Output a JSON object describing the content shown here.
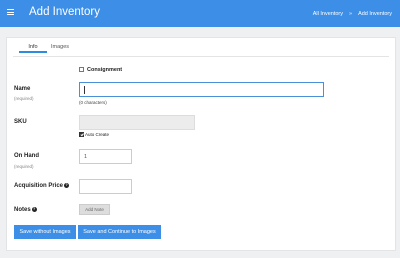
{
  "header": {
    "title": "Add Inventory",
    "breadcrumbs": [
      "All Inventory",
      "Add Inventory"
    ],
    "breadcrumb_separator": "»"
  },
  "tabs": [
    {
      "label": "Info",
      "active": true
    },
    {
      "label": "Images",
      "active": false
    }
  ],
  "form": {
    "consignment_label": "Consignment",
    "name_label": "Name",
    "name_required": "(required)",
    "name_value": "",
    "name_counter": "(0 characters)",
    "sku_label": "SKU",
    "sku_value": "",
    "auto_create_label": "Auto Create",
    "on_hand_label": "On Hand",
    "on_hand_required": "(required)",
    "on_hand_value": "1",
    "acquisition_label": "Acquisition Price",
    "acquisition_value": "",
    "notes_label": "Notes",
    "add_note_label": "Add Note"
  },
  "buttons": {
    "save_without_images": "Save without Images",
    "save_continue": "Save and Continue to Images"
  },
  "colors": {
    "primary": "#3c8ee6",
    "background": "#eef0f2"
  }
}
